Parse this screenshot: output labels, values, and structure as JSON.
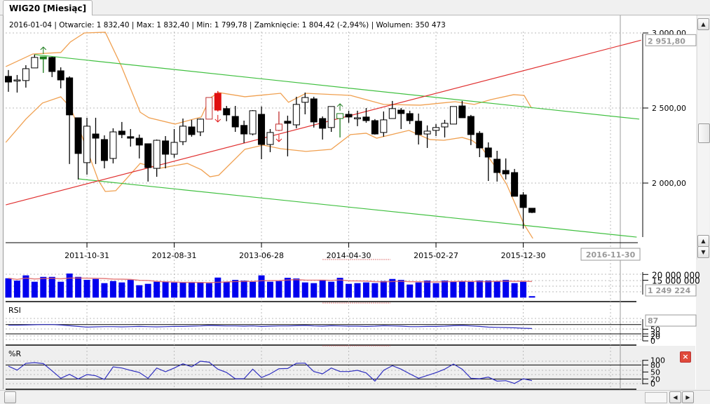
{
  "tab": {
    "label": "WIG20 [Miesiąc]"
  },
  "info": {
    "date": "2016-01-04",
    "open": "Otwarcie: 1 832,40",
    "max": "Max: 1 832,40",
    "min": "Min: 1 799,78",
    "close": "Zamknięcie: 1 804,42 (-2,94%)",
    "volume": "Wolumen: 350 473"
  },
  "icons": {
    "scroll_up": "arrow-up",
    "scroll_down": "arrow-down",
    "scroll_left": "arrow-left",
    "scroll_right": "arrow-right",
    "close": "close-x"
  },
  "colors": {
    "up_signal": "#1a7a1a",
    "down_signal": "#e01010",
    "band": "#f0a050",
    "trend_up": "#e03030",
    "channel": "#40c040",
    "volume": "#0000ee",
    "indicator": "#3030c0"
  },
  "chart_data": {
    "type": "candlestick",
    "title": "WIG20 [Miesiąc]",
    "price_axis": {
      "ylim": [
        1640,
        3030
      ],
      "ticks": [
        {
          "value": 3000,
          "label": "3 000,00"
        },
        {
          "value": 2500,
          "label": "2 500,00"
        },
        {
          "value": 2000,
          "label": "2 000,00"
        }
      ],
      "current_label": "2 951,80",
      "current_value": 2951.8
    },
    "date_ticks": [
      {
        "index": 10,
        "label": "2011-10-31"
      },
      {
        "index": 20,
        "label": "2012-08-31"
      },
      {
        "index": 30,
        "label": "2013-06-28"
      },
      {
        "index": 40,
        "label": "2014-04-30"
      },
      {
        "index": 50,
        "label": "2015-02-27"
      },
      {
        "index": 60,
        "label": "2015-12-30"
      }
    ],
    "cursor_date": {
      "index": 70,
      "label": "2016-11-30"
    },
    "candles_ohlc": [
      [
        2711,
        2753,
        2608,
        2673
      ],
      [
        2687,
        2720,
        2603,
        2687
      ],
      [
        2683,
        2785,
        2636,
        2762
      ],
      [
        2767,
        2856,
        2767,
        2837
      ],
      [
        2827,
        2841,
        2734,
        2841
      ],
      [
        2837,
        2841,
        2706,
        2743
      ],
      [
        2748,
        2771,
        2631,
        2687
      ],
      [
        2701,
        2711,
        2127,
        2454
      ],
      [
        2435,
        2435,
        2024,
        2197
      ],
      [
        2136,
        2435,
        2056,
        2379
      ],
      [
        2327,
        2435,
        2127,
        2299
      ],
      [
        2290,
        2318,
        2098,
        2150
      ],
      [
        2164,
        2365,
        2131,
        2341
      ],
      [
        2346,
        2407,
        2299,
        2323
      ],
      [
        2309,
        2360,
        2243,
        2299
      ],
      [
        2299,
        2323,
        2164,
        2253
      ],
      [
        2262,
        2262,
        2010,
        2103
      ],
      [
        2098,
        2290,
        2042,
        2285
      ],
      [
        2281,
        2313,
        2098,
        2192
      ],
      [
        2192,
        2360,
        2169,
        2271
      ],
      [
        2276,
        2430,
        2253,
        2379
      ],
      [
        2374,
        2421,
        2309,
        2323
      ],
      [
        2341,
        2430,
        2313,
        2426
      ],
      [
        2426,
        2570,
        2426,
        2570
      ],
      [
        2598,
        2613,
        2477,
        2486
      ],
      [
        2496,
        2514,
        2412,
        2454
      ],
      [
        2444,
        2514,
        2341,
        2374
      ],
      [
        2384,
        2416,
        2267,
        2327
      ],
      [
        2327,
        2486,
        2318,
        2482
      ],
      [
        2458,
        2510,
        2159,
        2257
      ],
      [
        2257,
        2360,
        2206,
        2337
      ],
      [
        2351,
        2477,
        2346,
        2393
      ],
      [
        2412,
        2449,
        2178,
        2398
      ],
      [
        2388,
        2575,
        2365,
        2524
      ],
      [
        2538,
        2603,
        2458,
        2570
      ],
      [
        2561,
        2575,
        2370,
        2407
      ],
      [
        2430,
        2444,
        2290,
        2365
      ],
      [
        2370,
        2510,
        2341,
        2510
      ],
      [
        2430,
        2463,
        2304,
        2463
      ],
      [
        2458,
        2482,
        2402,
        2440
      ],
      [
        2435,
        2482,
        2379,
        2435
      ],
      [
        2440,
        2500,
        2402,
        2416
      ],
      [
        2416,
        2426,
        2323,
        2327
      ],
      [
        2337,
        2477,
        2309,
        2421
      ],
      [
        2430,
        2547,
        2430,
        2496
      ],
      [
        2486,
        2500,
        2360,
        2463
      ],
      [
        2463,
        2482,
        2393,
        2416
      ],
      [
        2412,
        2463,
        2257,
        2323
      ],
      [
        2327,
        2384,
        2234,
        2346
      ],
      [
        2351,
        2393,
        2313,
        2370
      ],
      [
        2374,
        2421,
        2304,
        2398
      ],
      [
        2393,
        2510,
        2393,
        2510
      ],
      [
        2514,
        2547,
        2435,
        2435
      ],
      [
        2444,
        2454,
        2253,
        2323
      ],
      [
        2332,
        2346,
        2173,
        2234
      ],
      [
        2234,
        2271,
        2014,
        2173
      ],
      [
        2159,
        2215,
        2010,
        2070
      ],
      [
        2084,
        2164,
        2024,
        2061
      ],
      [
        2070,
        2094,
        1912,
        1912
      ],
      [
        1921,
        1940,
        1697,
        1837
      ],
      [
        1832.4,
        1832.4,
        1799.78,
        1804.42
      ]
    ],
    "candle_marks": {
      "5": "green-filled",
      "24": "red-outline",
      "25": "red-filled",
      "32": "red-outline",
      "39": "green-outline"
    },
    "signals": [
      {
        "index": 5,
        "type": "buy"
      },
      {
        "index": 39,
        "type": "buy"
      },
      {
        "index": 25,
        "type": "sell"
      },
      {
        "index": 32,
        "type": "sell"
      }
    ],
    "bollinger_upper": [
      [
        0.7,
        2776
      ],
      [
        3.8,
        2860
      ],
      [
        7,
        2870
      ],
      [
        8.1,
        2940
      ],
      [
        9.7,
        3000
      ],
      [
        12.1,
        3005
      ],
      [
        13.9,
        2785
      ],
      [
        16.1,
        2472
      ],
      [
        17.1,
        2435
      ],
      [
        20.1,
        2393
      ],
      [
        23.1,
        2440
      ],
      [
        24.1,
        2566
      ],
      [
        25.1,
        2603
      ],
      [
        28.1,
        2575
      ],
      [
        32.2,
        2598
      ],
      [
        33.1,
        2538
      ],
      [
        35.1,
        2598
      ],
      [
        40.2,
        2584
      ],
      [
        44,
        2524
      ],
      [
        48.2,
        2519
      ],
      [
        52.2,
        2542
      ],
      [
        54.4,
        2524
      ],
      [
        56.3,
        2556
      ],
      [
        58.9,
        2589
      ],
      [
        60.1,
        2584
      ],
      [
        60.9,
        2505
      ]
    ],
    "bollinger_lower": [
      [
        0.7,
        2271
      ],
      [
        3,
        2426
      ],
      [
        4.9,
        2533
      ],
      [
        7,
        2575
      ],
      [
        8.1,
        2505
      ],
      [
        9.4,
        2318
      ],
      [
        11.3,
        2019
      ],
      [
        12.1,
        1944
      ],
      [
        13.3,
        1949
      ],
      [
        16.1,
        2131
      ],
      [
        18.3,
        2098
      ],
      [
        21.5,
        2131
      ],
      [
        23.1,
        2089
      ],
      [
        24.1,
        2042
      ],
      [
        25.1,
        2052
      ],
      [
        28.1,
        2225
      ],
      [
        30.2,
        2253
      ],
      [
        32.2,
        2229
      ],
      [
        35.1,
        2211
      ],
      [
        38,
        2225
      ],
      [
        40.2,
        2323
      ],
      [
        42,
        2332
      ],
      [
        43.2,
        2299
      ],
      [
        46.9,
        2351
      ],
      [
        49.3,
        2290
      ],
      [
        50.9,
        2285
      ],
      [
        53,
        2304
      ],
      [
        54.1,
        2285
      ],
      [
        55.2,
        2239
      ],
      [
        57.1,
        2084
      ],
      [
        58.1,
        1991
      ],
      [
        60.1,
        1724
      ],
      [
        61.1,
        1631
      ]
    ],
    "trendlines": [
      {
        "name": "channel-upper",
        "color": "#40c040",
        "points": [
          [
            4,
            2856
          ],
          [
            73.3,
            2426
          ]
        ]
      },
      {
        "name": "channel-lower",
        "color": "#40c040",
        "points": [
          [
            9,
            2028
          ],
          [
            73,
            1640
          ]
        ]
      },
      {
        "name": "support-rising",
        "color": "#e03030",
        "points": [
          [
            0.7,
            1855
          ],
          [
            73.5,
            2951.8
          ]
        ]
      }
    ],
    "volume": {
      "ticks": [
        {
          "value": 20000000,
          "label": "20 000 000"
        },
        {
          "value": 15000000,
          "label": "15 000 000"
        }
      ],
      "current_label": "1 249 224",
      "values_millions": [
        16.7,
        14.7,
        19.2,
        13.7,
        17.9,
        17.9,
        13.7,
        20.8,
        17.9,
        15.3,
        16.1,
        12.5,
        14.3,
        13.1,
        15.3,
        10.7,
        11.9,
        13.7,
        13.7,
        13.1,
        13.1,
        13.1,
        13.1,
        12.5,
        17.3,
        13.7,
        15.3,
        14.7,
        13.7,
        19.2,
        13.7,
        14.3,
        17.1,
        16.5,
        13.1,
        12.5,
        15.3,
        13.7,
        17.1,
        11.9,
        12.5,
        13.1,
        12.5,
        14.3,
        16.1,
        15.3,
        11.3,
        13.1,
        14.7,
        12.5,
        14.7,
        13.7,
        14.3,
        13.7,
        14.7,
        14.7,
        14.3,
        15.3,
        12.5,
        13.7,
        1.249224
      ]
    },
    "rsi": {
      "label": "RSI",
      "current_label": "87",
      "ticks": [
        {
          "value": 50,
          "label": "50"
        },
        {
          "value": 30,
          "label": "30"
        },
        {
          "value": 20,
          "label": "20"
        },
        {
          "value": 0,
          "label": "0"
        }
      ],
      "levels": [
        70,
        30
      ],
      "values": [
        67,
        67,
        68,
        69,
        70,
        70,
        68,
        65,
        62,
        59,
        60,
        61,
        61,
        60,
        61,
        62,
        61,
        60,
        61,
        62,
        62,
        63,
        64,
        66,
        65,
        64,
        64,
        63,
        64,
        62,
        63,
        64,
        64,
        65,
        66,
        64,
        63,
        65,
        64,
        63,
        63,
        62,
        63,
        65,
        64,
        63,
        61,
        61,
        62,
        62,
        63,
        65,
        66,
        64,
        62,
        59,
        58,
        57,
        56,
        54,
        53
      ]
    },
    "williams_r": {
      "label": "%R",
      "ticks": [
        {
          "value": 100,
          "label": "100"
        },
        {
          "value": 80,
          "label": "80"
        },
        {
          "value": 50,
          "label": "50"
        },
        {
          "value": 20,
          "label": "20"
        },
        {
          "value": 0,
          "label": "0"
        }
      ],
      "levels": [
        80,
        20
      ],
      "values": [
        75,
        58,
        87,
        90,
        86,
        55,
        23,
        40,
        20,
        39,
        34,
        18,
        72,
        67,
        57,
        48,
        23,
        67,
        51,
        67,
        85,
        72,
        96,
        92,
        62,
        48,
        21,
        21,
        62,
        26,
        42,
        64,
        65,
        87,
        88,
        52,
        42,
        67,
        52,
        52,
        57,
        46,
        11,
        57,
        77,
        62,
        42,
        23,
        35,
        47,
        62,
        84,
        62,
        23,
        21,
        28,
        11,
        13,
        1,
        21,
        13
      ]
    }
  }
}
